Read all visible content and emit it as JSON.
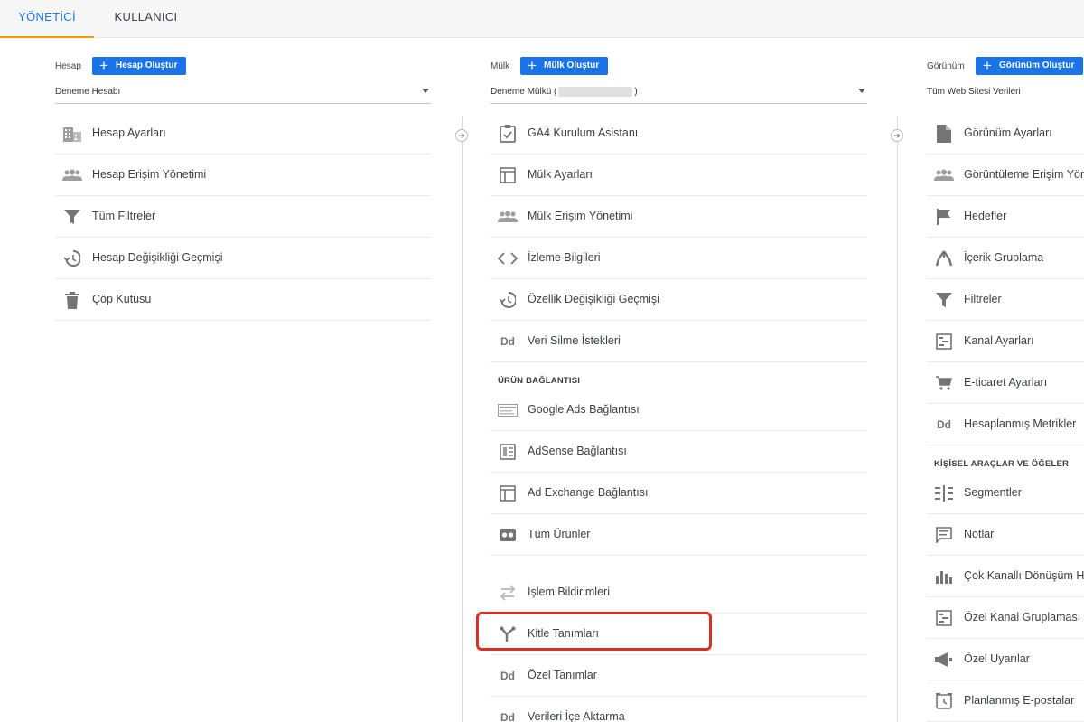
{
  "tabs": {
    "admin": "YÖNETİCİ",
    "user": "KULLANICI"
  },
  "account": {
    "label": "Hesap",
    "create_button": "Hesap Oluştur",
    "selected": "Deneme Hesabı",
    "items": [
      {
        "label": "Hesap Ayarları",
        "icon": "building-icon"
      },
      {
        "label": "Hesap Erişim Yönetimi",
        "icon": "people-icon"
      },
      {
        "label": "Tüm Filtreler",
        "icon": "filter-icon"
      },
      {
        "label": "Hesap Değişikliği Geçmişi",
        "icon": "history-icon"
      },
      {
        "label": "Çöp Kutusu",
        "icon": "trash-icon"
      }
    ]
  },
  "property": {
    "label": "Mülk",
    "create_button": "Mülk Oluştur",
    "selected_prefix": "Deneme Mülkü (",
    "selected_suffix": ")",
    "items": [
      {
        "label": "GA4 Kurulum Asistanı",
        "icon": "clipboard-check-icon"
      },
      {
        "label": "Mülk Ayarları",
        "icon": "layout-icon"
      },
      {
        "label": "Mülk Erişim Yönetimi",
        "icon": "people-icon"
      },
      {
        "label": "İzleme Bilgileri",
        "icon": "code-icon"
      },
      {
        "label": "Özellik Değişikliği Geçmişi",
        "icon": "history-icon"
      },
      {
        "label": "Veri Silme İstekleri",
        "icon": "dd-icon"
      }
    ],
    "section_title": "ÜRÜN BAĞLANTISI",
    "link_items": [
      {
        "label": "Google Ads Bağlantısı",
        "icon": "ads-icon"
      },
      {
        "label": "AdSense Bağlantısı",
        "icon": "adsense-icon"
      },
      {
        "label": "Ad Exchange Bağlantısı",
        "icon": "layout-icon"
      },
      {
        "label": "Tüm Ürünler",
        "icon": "products-icon"
      }
    ],
    "more_items": [
      {
        "label": "İşlem Bildirimleri",
        "icon": "postback-icon"
      },
      {
        "label": "Kitle Tanımları",
        "icon": "audience-icon"
      },
      {
        "label": "Özel Tanımlar",
        "icon": "dd-icon"
      },
      {
        "label": "Verileri İçe Aktarma",
        "icon": "dd-icon"
      }
    ],
    "dd_text": "Dd"
  },
  "view": {
    "label": "Görünüm",
    "create_button": "Görünüm Oluştur",
    "selected": "Tüm Web Sitesi Verileri",
    "items": [
      {
        "label": "Görünüm Ayarları",
        "icon": "document-icon"
      },
      {
        "label": "Görüntüleme Erişim Yönetimi",
        "icon": "people-icon"
      },
      {
        "label": "Hedefler",
        "icon": "flag-icon"
      },
      {
        "label": "İçerik Gruplama",
        "icon": "content-group-icon"
      },
      {
        "label": "Filtreler",
        "icon": "filter-icon"
      },
      {
        "label": "Kanal Ayarları",
        "icon": "channel-icon"
      },
      {
        "label": "E-ticaret Ayarları",
        "icon": "cart-icon"
      },
      {
        "label": "Hesaplanmış Metrikler",
        "icon": "dd-icon"
      }
    ],
    "section_title": "KİŞİSEL ARAÇLAR VE ÖĞELER",
    "personal_items": [
      {
        "label": "Segmentler",
        "icon": "segments-icon"
      },
      {
        "label": "Notlar",
        "icon": "notes-icon"
      },
      {
        "label": "Çok Kanallı Dönüşüm Hunisi",
        "icon": "bar-chart-icon"
      },
      {
        "label": "Özel Kanal Gruplaması",
        "icon": "channel-icon"
      },
      {
        "label": "Özel Uyarılar",
        "icon": "megaphone-icon"
      },
      {
        "label": "Planlanmış E-postalar",
        "icon": "alarm-icon"
      }
    ],
    "dd_text": "Dd"
  },
  "colors": {
    "accent": "#1a73e8",
    "tab_underline": "#f29900",
    "highlight": "#d93025",
    "icon": "#757575"
  }
}
